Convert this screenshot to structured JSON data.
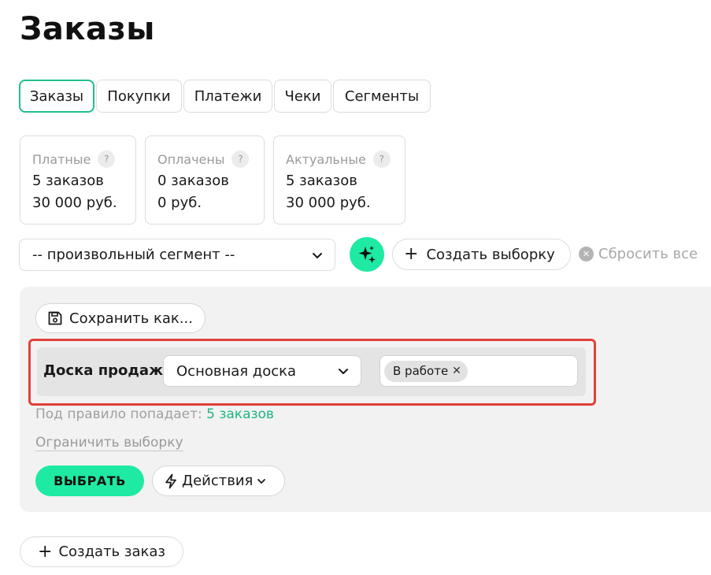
{
  "page": {
    "title": "Заказы"
  },
  "tabs": [
    {
      "label": "Заказы",
      "active": true
    },
    {
      "label": "Покупки",
      "active": false
    },
    {
      "label": "Платежи",
      "active": false
    },
    {
      "label": "Чеки",
      "active": false
    },
    {
      "label": "Сегменты",
      "active": false
    }
  ],
  "stats": [
    {
      "title": "Платные",
      "help": "?",
      "count": "5 заказов",
      "amount": "30 000 руб."
    },
    {
      "title": "Оплачены",
      "help": "?",
      "count": "0 заказов",
      "amount": "0 руб."
    },
    {
      "title": "Актуальные",
      "help": "?",
      "count": "5 заказов",
      "amount": "30 000 руб."
    }
  ],
  "toolbar": {
    "segment_value": "-- произвольный сегмент --",
    "create_selection_label": "Создать выборку",
    "reset_all_label": "Сбросить все"
  },
  "filter": {
    "save_as_label": "Сохранить как...",
    "rule_label": "Доска продаж",
    "board_value": "Основная доска",
    "tag_label": "В работе",
    "match_prefix": "Под правило попадает:",
    "match_count": "5 заказов",
    "limit_label": "Ограничить выборку",
    "select_label": "ВЫБРАТЬ",
    "actions_label": "Действия"
  },
  "footer": {
    "create_order_label": "Создать заказ"
  },
  "colors": {
    "accent": "#1eeaa4",
    "accent_text": "#1fb584",
    "highlight": "#e0413a"
  }
}
